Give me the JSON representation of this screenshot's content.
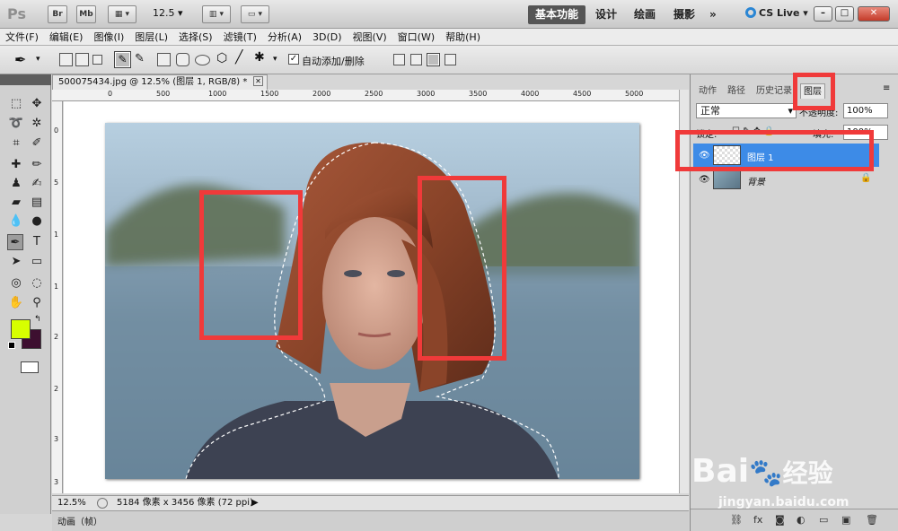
{
  "app": {
    "logo": "Ps",
    "bridge": "Br",
    "minibridge": "Mb",
    "zoom": "12.5",
    "workspaces": [
      {
        "label": "基本功能",
        "active": true
      },
      {
        "label": "设计",
        "active": false
      },
      {
        "label": "绘画",
        "active": false
      },
      {
        "label": "摄影",
        "active": false
      }
    ],
    "more": "»",
    "cslive": "CS Live"
  },
  "menu": [
    "文件(F)",
    "编辑(E)",
    "图像(I)",
    "图层(L)",
    "选择(S)",
    "滤镜(T)",
    "分析(A)",
    "3D(D)",
    "视图(V)",
    "窗口(W)",
    "帮助(H)"
  ],
  "options": {
    "auto_add_delete": "自动添加/删除",
    "auto_checked": "✓"
  },
  "document": {
    "tab_title": "500075434.jpg @ 12.5% (图层 1, RGB/8) *",
    "ruler_top": [
      "0",
      "500",
      "1000",
      "1500",
      "2000",
      "2500",
      "3000",
      "3500",
      "4000",
      "4500",
      "5000"
    ],
    "ruler_left": [
      "0",
      "5",
      "1",
      "1",
      "2",
      "2",
      "3",
      "3"
    ],
    "zoom": "12.5%",
    "doc_info": "5184 像素 x 3456 像素 (72 ppi)"
  },
  "bottom": {
    "tab": "动画（帧）"
  },
  "panel": {
    "tabs": [
      {
        "label": "动作",
        "active": false
      },
      {
        "label": "路径",
        "active": false
      },
      {
        "label": "历史记录",
        "active": false
      },
      {
        "label": "图层",
        "active": true
      }
    ],
    "blend_mode": "正常",
    "opacity_label": "不透明度:",
    "opacity": "100%",
    "lock_label": "锁定:",
    "fill_label": "填充:",
    "fill": "100%",
    "layers": [
      {
        "name": "图层 1",
        "selected": true
      },
      {
        "name": "背景",
        "selected": false
      }
    ]
  },
  "watermark": {
    "brand": "Bai",
    "brand2": "经验",
    "url": "jingyan.baidu.com"
  }
}
